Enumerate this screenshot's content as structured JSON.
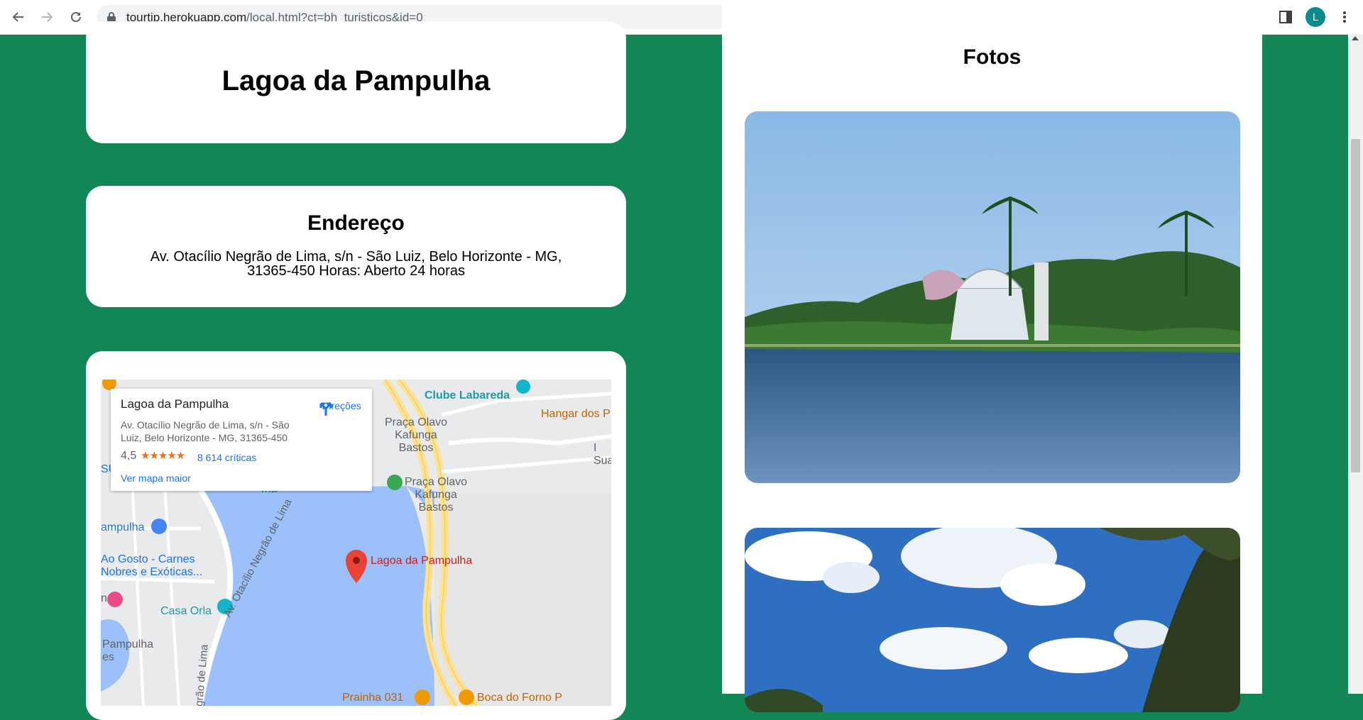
{
  "browser": {
    "url_domain": "tourtip.herokuapp.com",
    "url_path": "/local.html?ct=bh_turisticos&id=0",
    "profile_initial": "L"
  },
  "place": {
    "title": "Lagoa da Pampulha"
  },
  "address": {
    "heading": "Endereço",
    "text": "Av. Otacílio Negrão de Lima, s/n - São Luiz, Belo Horizonte - MG, 31365-450 Horas: Aberto 24 horas"
  },
  "map": {
    "popup": {
      "title": "Lagoa da Pampulha",
      "address": "Av. Otacílio Negrão de Lima, s/n - São Luiz, Belo Horizonte - MG, 31365-450",
      "rating": "4,5",
      "stars": "★★★★★",
      "reviews": "8 614 críticas",
      "bigger_map": "Ver mapa maior",
      "directions": "Direções"
    },
    "labels": {
      "clube": "Clube Labareda",
      "hangar": "Hangar dos P",
      "praca1": "Praça Olavo\nKafunga\nBastos",
      "praca2": "Praça Olavo\nKafunga\nBastos",
      "sua": "I\nSua",
      "pampulha_left": "ampulha",
      "gosto": "Ao Gosto - Carnes\nNobres e Exóticas...",
      "casa_orla": "Casa Orla",
      "pampulha_bottom": "Pampulha\nes",
      "avenue": "Av. Otacílio Negrão de Lima",
      "avenue2": "grão de Lima",
      "marker": "Lagoa da Pampulha",
      "prainha": "Prainha 031",
      "boca": "Boca do Forno P",
      "su": "SU",
      "ma": "ma",
      "n": "n"
    }
  },
  "photos": {
    "heading": "Fotos"
  },
  "colors": {
    "page_bg": "#138656",
    "map_water": "#9cc0f9",
    "map_road": "#fde293"
  }
}
